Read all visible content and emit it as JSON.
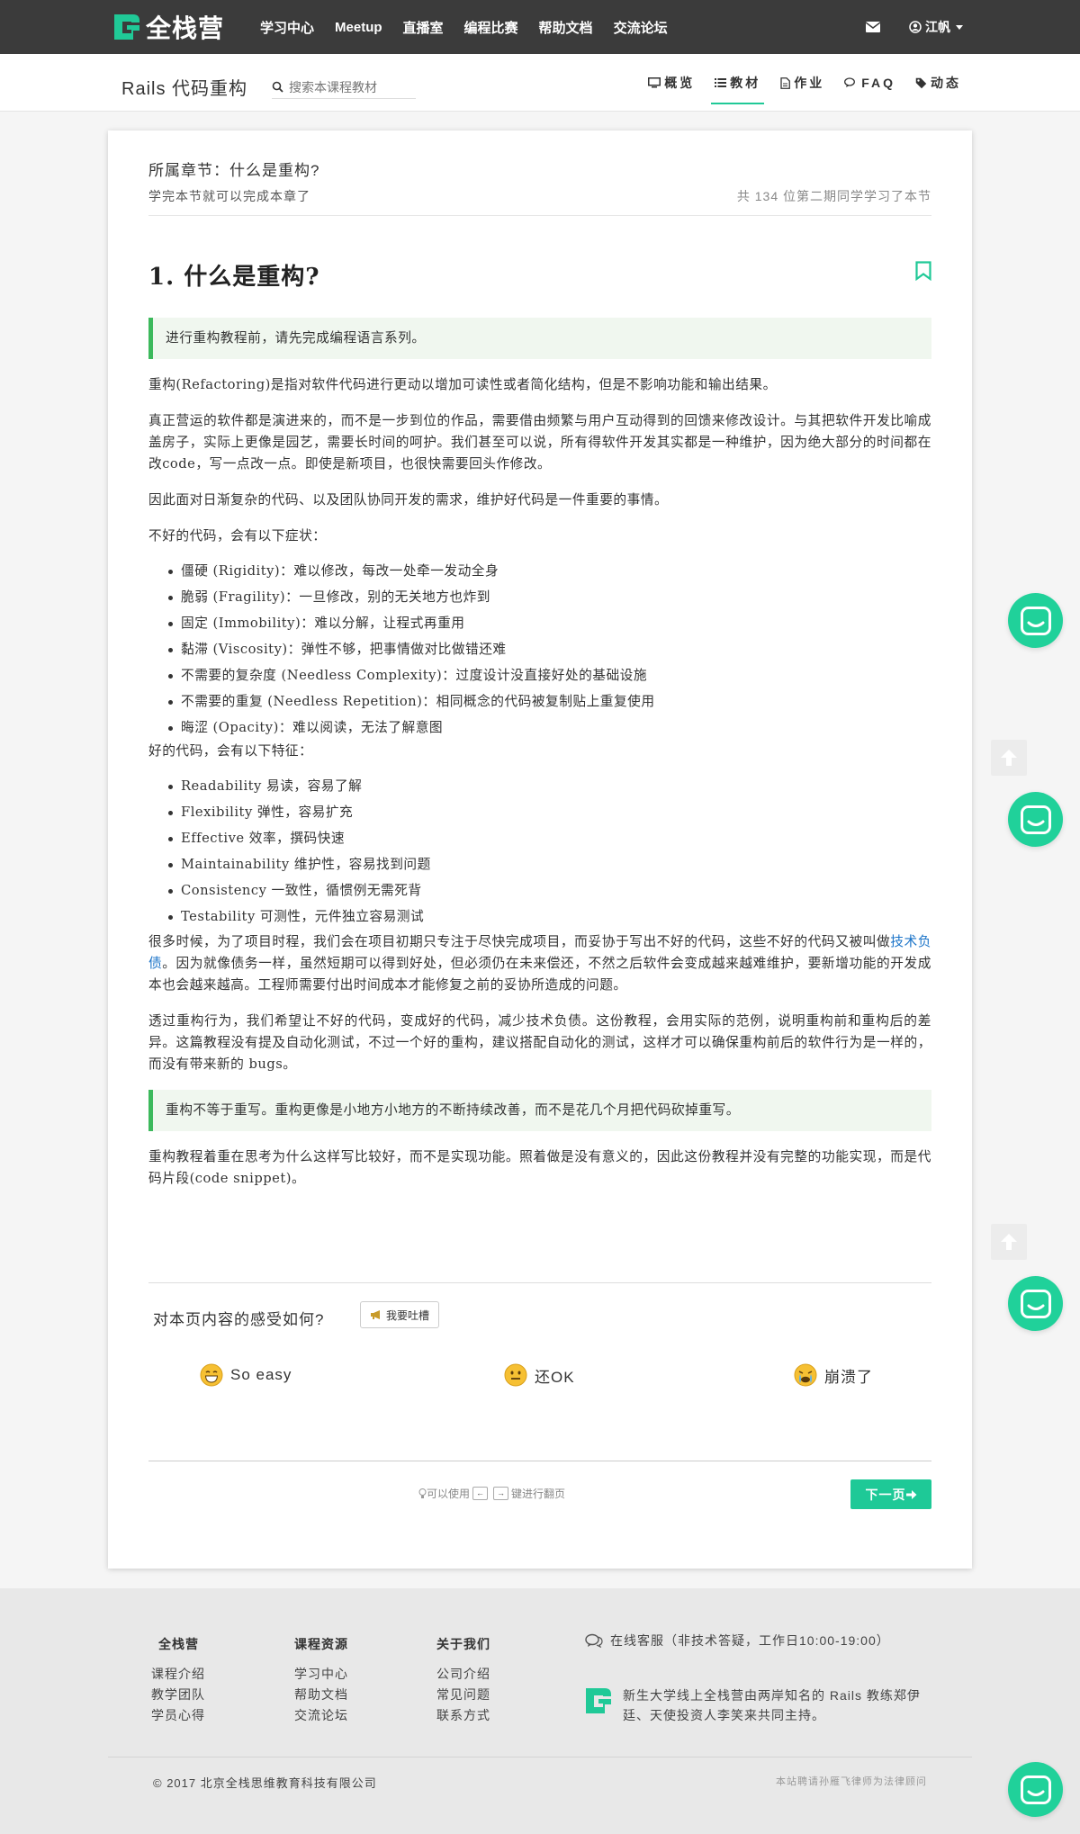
{
  "brand": {
    "name": "全栈营",
    "accent": "#20c997"
  },
  "nav": {
    "links": [
      "学习中心",
      "Meetup",
      "直播室",
      "编程比赛",
      "帮助文档",
      "交流论坛"
    ],
    "user": "江帆"
  },
  "course": {
    "title": "Rails 代码重构",
    "search_placeholder": "搜索本课程教材",
    "tabs": [
      "概览",
      "教材",
      "作业",
      "FAQ",
      "动态"
    ],
    "active_tab": "教材"
  },
  "chapter": {
    "title": "所属章节：什么是重构?",
    "subtitle": "学完本节就可以完成本章了",
    "count": "共 134 位第二期同学学习了本节"
  },
  "article": {
    "heading": "1. 什么是重构?",
    "note1": "进行重构教程前，请先完成编程语言系列。",
    "p1": "重构(Refactoring)是指对软件代码进行更动以增加可读性或者简化结构，但是不影响功能和输出结果。",
    "p2": "真正营运的软件都是演进来的，而不是一步到位的作品，需要借由频繁与用户互动得到的回馈来修改设计。与其把软件开发比喻成盖房子，实际上更像是园艺，需要长时间的呵护。我们甚至可以说，所有得软件开发其实都是一种维护，因为绝大部分的时间都在改code，写一点改一点。即使是新项目，也很快需要回头作修改。",
    "p3": "因此面对日渐复杂的代码、以及团队协同开发的需求，维护好代码是一件重要的事情。",
    "bad_intro": "不好的代码，会有以下症状：",
    "bad_list": [
      "僵硬 (Rigidity)：难以修改，每改一处牵一发动全身",
      "脆弱 (Fragility)：一旦修改，别的无关地方也炸到",
      "固定 (Immobility)：难以分解，让程式再重用",
      "黏滞 (Viscosity)：弹性不够，把事情做对比做错还难",
      "不需要的复杂度 (Needless Complexity)：过度设计没直接好处的基础设施",
      "不需要的重复 (Needless Repetition)：相同概念的代码被复制贴上重复使用",
      "晦涩 (Opacity)：难以阅读，无法了解意图"
    ],
    "good_intro": "好的代码，会有以下特征：",
    "good_list": [
      "Readability 易读，容易了解",
      "Flexibility 弹性，容易扩充",
      "Effective 效率，撰码快速",
      "Maintainability 维护性，容易找到问题",
      "Consistency 一致性，循惯例无需死背",
      "Testability 可测性，元件独立容易测试"
    ],
    "p4_a": "很多时候，为了项目时程，我们会在项目初期只专注于尽快完成项目，而妥协于写出不好的代码，这些不好的代码又被叫做",
    "p4_link": "技术负债",
    "p4_b": "。因为就像债务一样，虽然短期可以得到好处，但必须仍在未来偿还，不然之后软件会变成越来越难维护，要新增功能的开发成本也会越来越高。工程师需要付出时间成本才能修复之前的妥协所造成的问题。",
    "p5": "透过重构行为，我们希望让不好的代码，变成好的代码，减少技术负债。这份教程，会用实际的范例，说明重构前和重构后的差异。这篇教程没有提及自动化测试，不过一个好的重构，建议搭配自动化的测试，这样才可以确保重构前后的软件行为是一样的，而没有带来新的 bugs。",
    "note2": "重构不等于重写。重构更像是小地方小地方的不断持续改善，而不是花几个月把代码砍掉重写。",
    "p6": "重构教程着重在思考为什么这样写比较好，而不是实现功能。照着做是没有意义的，因此这份教程并没有完整的功能实现，而是代码片段(code snippet)。"
  },
  "feedback": {
    "question": "对本页内容的感受如何?",
    "tucao": "我要吐槽",
    "options": [
      "So easy",
      "还OK",
      "崩溃了"
    ]
  },
  "pager": {
    "hint_a": "可以使用",
    "hint_left": "←",
    "hint_right": "→",
    "hint_b": "键进行翻页",
    "next": "下一页"
  },
  "footer": {
    "col1": {
      "title": "全栈营",
      "items": [
        "课程介绍",
        "教学团队",
        "学员心得"
      ]
    },
    "col2": {
      "title": "课程资源",
      "items": [
        "学习中心",
        "帮助文档",
        "交流论坛"
      ]
    },
    "col3": {
      "title": "关于我们",
      "items": [
        "公司介绍",
        "常见问题",
        "联系方式"
      ]
    },
    "service": "在线客服（非技术答疑，工作日10:00-19:00）",
    "about": "新生大学线上全栈营由两岸知名的 Rails 教练郑伊廷、天使投资人李笑来共同主持。",
    "copyright": "© 2017 北京全栈思维教育科技有限公司",
    "legal": "本站聘请孙雁飞律师为法律顾问"
  }
}
